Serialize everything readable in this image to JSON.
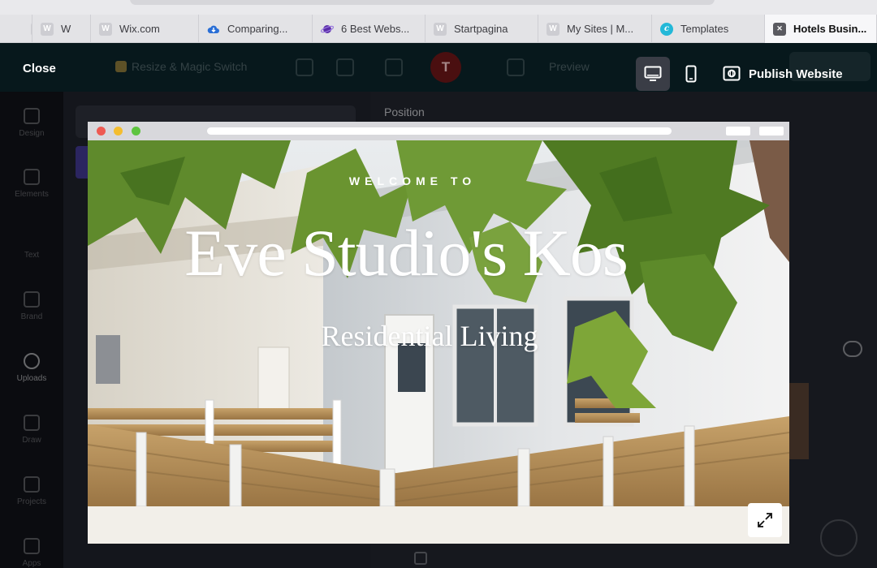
{
  "browser": {
    "tabs": [
      {
        "label": "",
        "favicon": "wordpress-icon"
      },
      {
        "label": "W",
        "favicon": "wordpress-icon"
      },
      {
        "label": "Wix.com",
        "favicon": "wordpress-icon"
      },
      {
        "label": "Comparing...",
        "favicon": "cloud-icon"
      },
      {
        "label": "6 Best Webs...",
        "favicon": "planet-icon"
      },
      {
        "label": "Startpagina",
        "favicon": "wordpress-icon"
      },
      {
        "label": "My Sites | M...",
        "favicon": "wordpress-icon"
      },
      {
        "label": "Templates",
        "favicon": "canva-icon"
      },
      {
        "label": "Hotels Busin...",
        "favicon": "close-icon"
      }
    ]
  },
  "toolbar": {
    "close_label": "Close",
    "resize_label": "Resize & Magic Switch",
    "avatar_initial": "T",
    "preview_label": "Preview",
    "publish_label": "Publish Website",
    "views": [
      "desktop-icon",
      "mobile-icon"
    ]
  },
  "rail": {
    "items": [
      "Design",
      "Elements",
      "Text",
      "Brand",
      "Uploads",
      "Draw",
      "Projects",
      "Apps"
    ]
  },
  "panel": {
    "position_label": "Position"
  },
  "hero": {
    "welcome": "WELCOME TO",
    "title": "Eve Studio's Kos",
    "subtitle": "Residential Living"
  },
  "colors": {
    "toolbar_bg": "#10363f",
    "canvas_bg": "#0d0f14",
    "window_bar": "#d8d8dc",
    "hero_text": "#ffffff"
  }
}
